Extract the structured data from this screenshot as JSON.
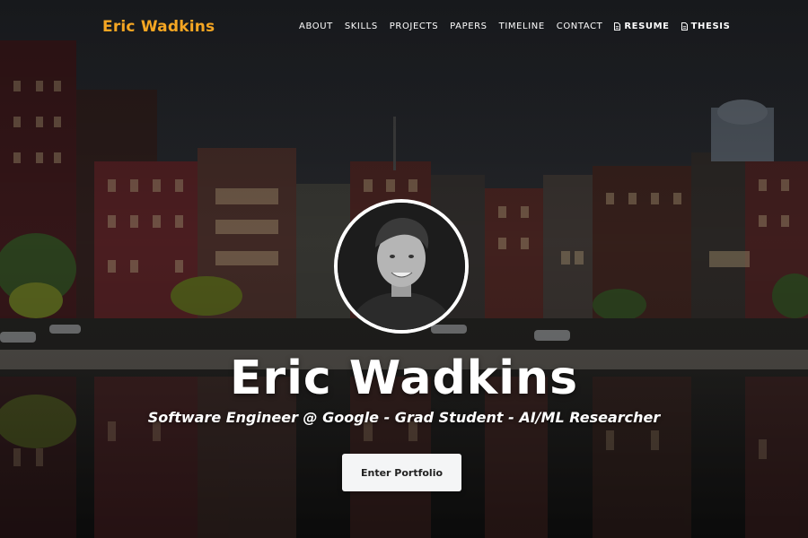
{
  "nav": {
    "brand": "Eric Wadkins",
    "links": [
      {
        "label": "ABOUT"
      },
      {
        "label": "SKILLS"
      },
      {
        "label": "PROJECTS"
      },
      {
        "label": "PAPERS"
      },
      {
        "label": "TIMELINE"
      },
      {
        "label": "CONTACT"
      },
      {
        "label": "RESUME",
        "icon": "document-icon"
      },
      {
        "label": "THESIS",
        "icon": "document-icon"
      }
    ]
  },
  "hero": {
    "name": "Eric Wadkins",
    "subtitle": "Software Engineer @ Google - Grad Student - AI/ML Researcher",
    "cta_label": "Enter Portfolio"
  },
  "colors": {
    "brand": "#f5a623",
    "text": "#ffffff",
    "button_bg": "#f4f5f6"
  }
}
